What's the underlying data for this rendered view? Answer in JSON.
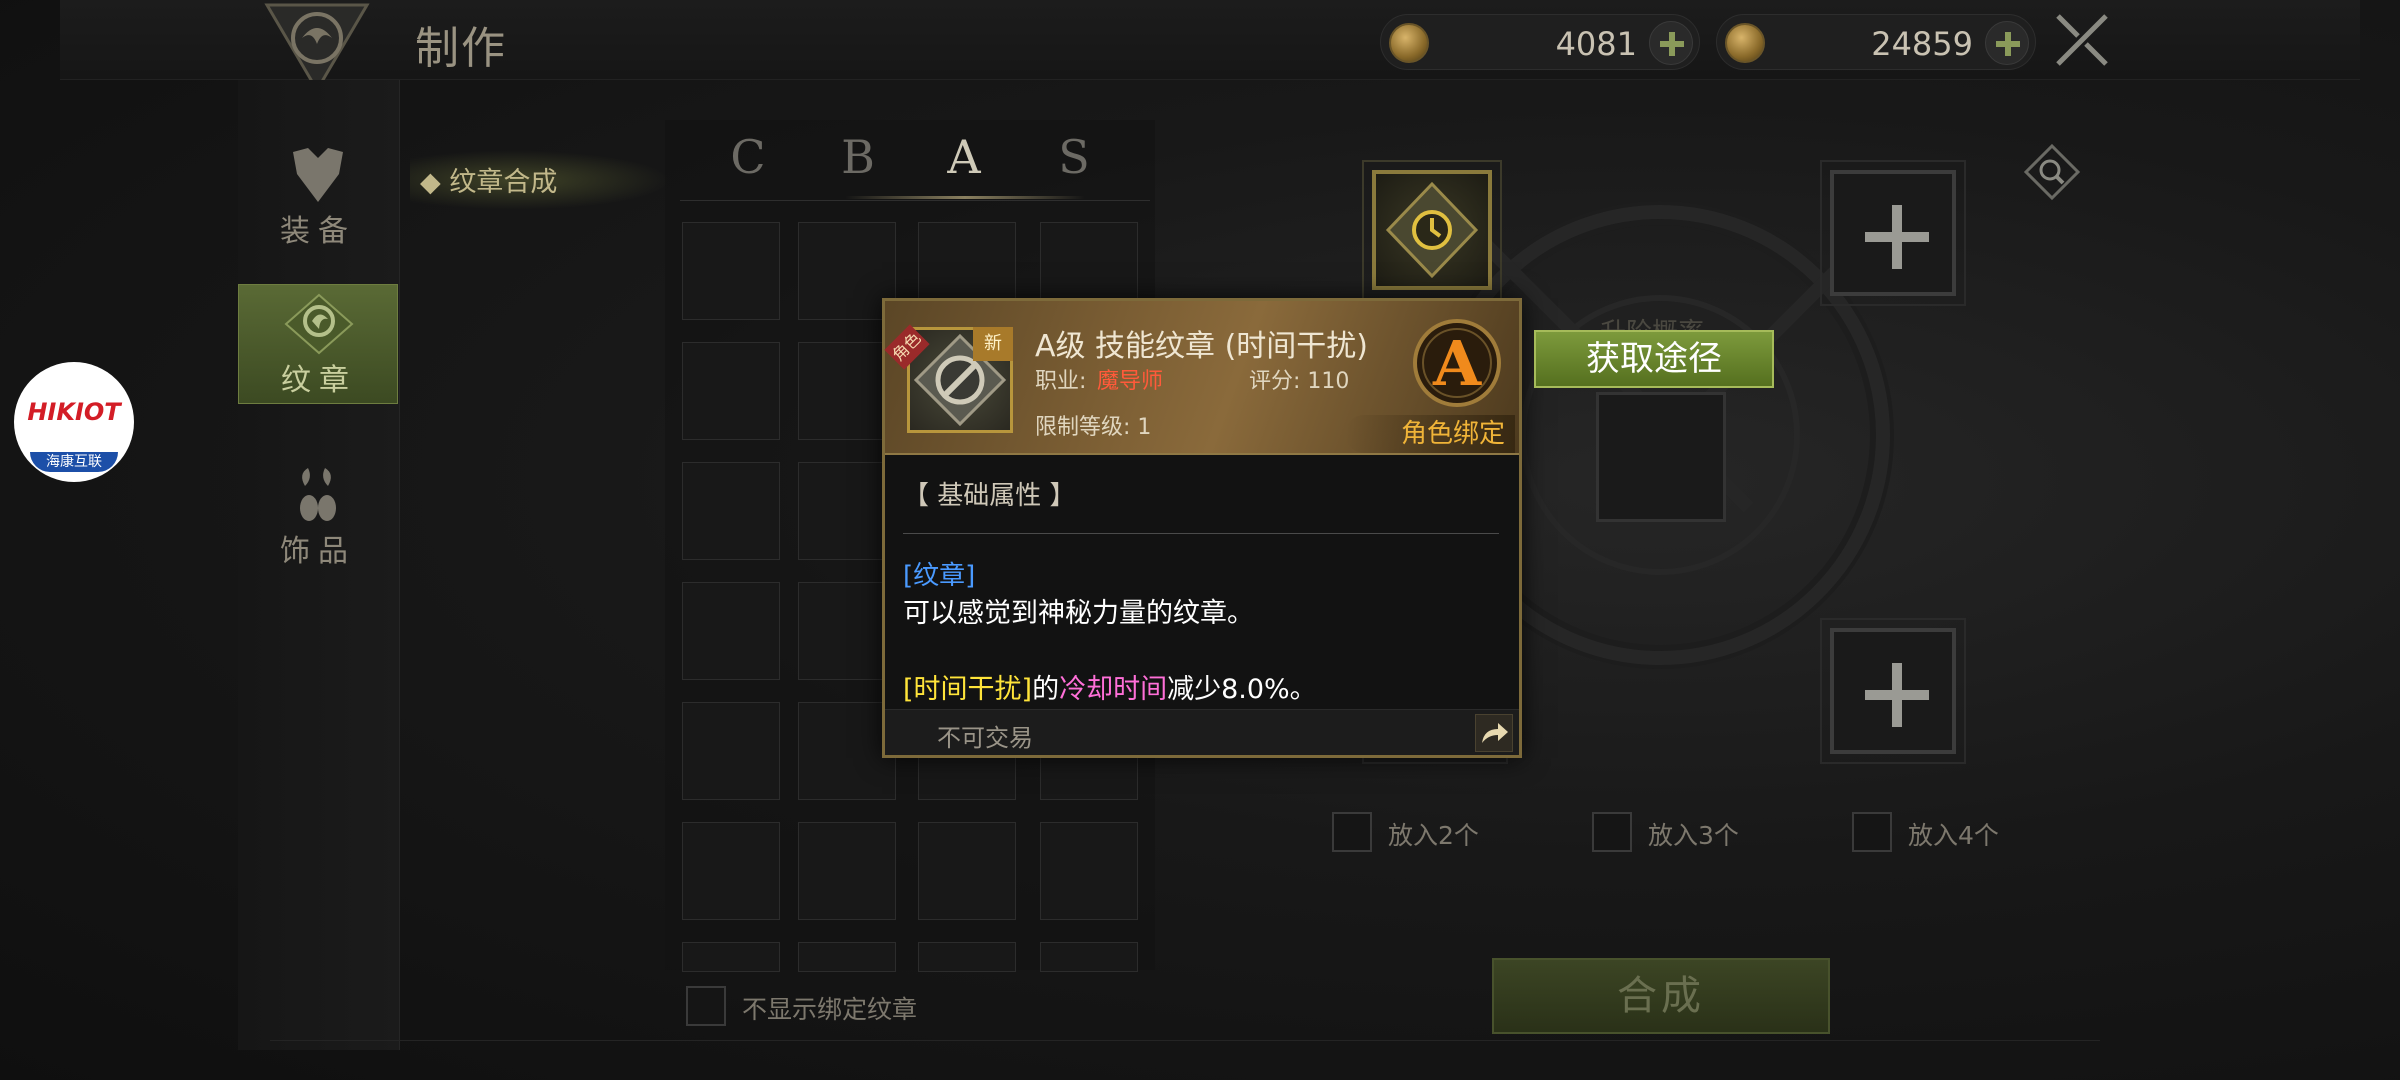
{
  "header": {
    "title": "制作"
  },
  "currencies": [
    {
      "amount": "4081",
      "icon": "coin-icon"
    },
    {
      "amount": "24859",
      "icon": "gold-coin-icon"
    }
  ],
  "nav": [
    {
      "label": "装备",
      "icon": "armor-icon",
      "active": false
    },
    {
      "label": "纹章",
      "icon": "dragon-crest-icon",
      "active": true
    },
    {
      "label": "饰品",
      "icon": "accessory-icon",
      "active": false
    }
  ],
  "category": {
    "label": "纹章合成"
  },
  "grades": [
    "C",
    "B",
    "A",
    "S"
  ],
  "active_grade": "A",
  "hide_bound": {
    "label": "不显示绑定纹章"
  },
  "put_options": [
    {
      "label": "放入2个"
    },
    {
      "label": "放入3个"
    },
    {
      "label": "放入4个"
    }
  ],
  "synth": {
    "obscured_title": "升阶概率",
    "button": "合成"
  },
  "badge": {
    "text": "HIKIOT",
    "sub": "海康互联"
  },
  "tooltip": {
    "name": "A级 技能纹章 (时间干扰)",
    "new_tag": "新",
    "bind_tag": "角色",
    "job_label": "职业:",
    "job_value": "魔导师",
    "score": "评分: 110",
    "level": "限制等级: 1",
    "grade": "A",
    "bound": "角色绑定",
    "section": "【 基础属性 】",
    "tag": "[纹章]",
    "desc": "可以感觉到神秘力量的纹章。",
    "effect": {
      "part1": "[时间干扰]",
      "part2": "的",
      "part3": "冷却时间",
      "part4": "减少8.0%。"
    },
    "trade": "不可交易"
  },
  "acquire": {
    "label": "获取途径"
  },
  "colors": {
    "accent_green": "#55701f",
    "grade_orange": "#f08a1c",
    "job_red": "#ff5a3a"
  }
}
